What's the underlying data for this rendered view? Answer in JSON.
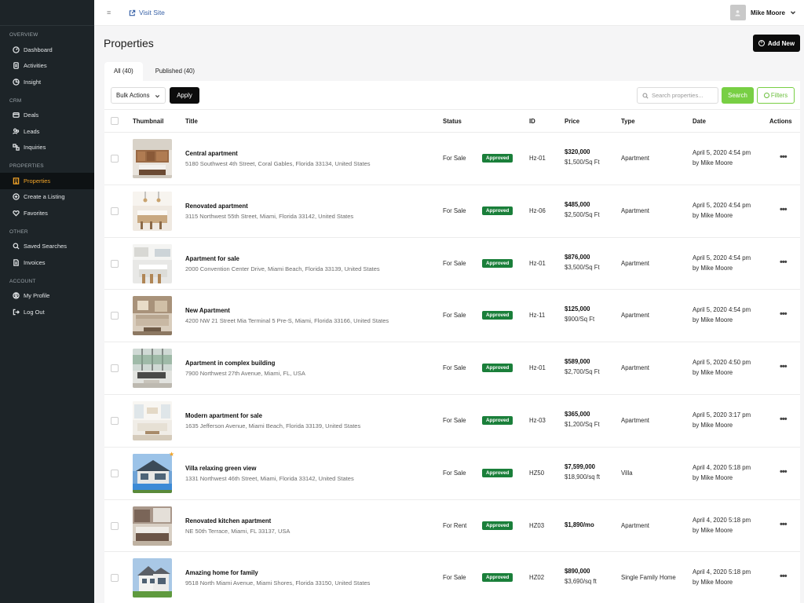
{
  "sidebar": {
    "sections": [
      {
        "title": "OVERVIEW",
        "items": [
          {
            "label": "Dashboard",
            "icon": "dashboard-icon"
          },
          {
            "label": "Activities",
            "icon": "activities-icon"
          },
          {
            "label": "Insight",
            "icon": "insight-icon"
          }
        ]
      },
      {
        "title": "CRM",
        "items": [
          {
            "label": "Deals",
            "icon": "deals-icon"
          },
          {
            "label": "Leads",
            "icon": "leads-icon"
          },
          {
            "label": "Inquiries",
            "icon": "inquiries-icon"
          }
        ]
      },
      {
        "title": "PROPERTIES",
        "items": [
          {
            "label": "Properties",
            "icon": "properties-icon",
            "active": true
          },
          {
            "label": "Create a Listing",
            "icon": "create-listing-icon"
          },
          {
            "label": "Favorites",
            "icon": "heart-icon"
          }
        ]
      },
      {
        "title": "OTHER",
        "items": [
          {
            "label": "Saved Searches",
            "icon": "search-icon"
          },
          {
            "label": "Invoices",
            "icon": "invoice-icon"
          }
        ]
      },
      {
        "title": "ACCOUNT",
        "items": [
          {
            "label": "My Profile",
            "icon": "profile-icon"
          },
          {
            "label": "Log Out",
            "icon": "logout-icon"
          }
        ]
      }
    ],
    "active_color": "#f2a428"
  },
  "topbar": {
    "visit_site": "Visit Site",
    "user_name": "Mike Moore"
  },
  "page": {
    "title": "Properties",
    "add_new": "Add New",
    "add_new_icon": "plus-circle-icon"
  },
  "tabs": [
    {
      "label": "All (40)",
      "active": true
    },
    {
      "label": "Published (40)",
      "active": false
    }
  ],
  "toolbar": {
    "bulk_actions": "Bulk Actions",
    "apply": "Apply",
    "search_placeholder": "Search properties...",
    "search": "Search",
    "filters": "Filters"
  },
  "table": {
    "headers": {
      "thumbnail": "Thumbnail",
      "title": "Title",
      "status": "Status",
      "id": "ID",
      "price": "Price",
      "type": "Type",
      "date": "Date",
      "actions": "Actions"
    },
    "rows": [
      {
        "title": "Central apartment",
        "address": "5180 Southwest 4th Street, Coral Gables, Florida 33134, United States",
        "status": "For Sale",
        "badge": "Approved",
        "id": "Hz-01",
        "price": "$320,000",
        "price_sub": "$1,500/Sq Ft",
        "type": "Apartment",
        "date": "April 5, 2020 4:54 pm",
        "by": "by Mike Moore",
        "thumb": "kitchen-wood",
        "featured": false
      },
      {
        "title": "Renovated apartment",
        "address": "3115 Northwest 55th Street, Miami, Florida 33142, United States",
        "status": "For Sale",
        "badge": "Approved",
        "id": "Hz-06",
        "price": "$485,000",
        "price_sub": "$2,500/Sq Ft",
        "type": "Apartment",
        "date": "April 5, 2020 4:54 pm",
        "by": "by Mike Moore",
        "thumb": "kitchen-light",
        "featured": false
      },
      {
        "title": "Apartment for sale",
        "address": "2000 Convention Center Drive, Miami Beach, Florida 33139, United States",
        "status": "For Sale",
        "badge": "Approved",
        "id": "Hz-01",
        "price": "$876,000",
        "price_sub": "$3,500/Sq Ft",
        "type": "Apartment",
        "date": "April 5, 2020 4:54 pm",
        "by": "by Mike Moore",
        "thumb": "kitchen-white",
        "featured": false
      },
      {
        "title": "New Apartment",
        "address": "4200 NW 21 Street Mia Terminal 5 Pre-S, Miami, Florida 33166, United States",
        "status": "For Sale",
        "badge": "Approved",
        "id": "Hz-11",
        "price": "$125,000",
        "price_sub": "$900/Sq Ft",
        "type": "Apartment",
        "date": "April 5, 2020 4:54 pm",
        "by": "by Mike Moore",
        "thumb": "living-warm",
        "featured": false
      },
      {
        "title": "Apartment in complex building",
        "address": "7900 Northwest 27th Avenue, Miami, FL, USA",
        "status": "For Sale",
        "badge": "Approved",
        "id": "Hz-01",
        "price": "$589,000",
        "price_sub": "$2,700/Sq Ft",
        "type": "Apartment",
        "date": "April 5, 2020 4:50 pm",
        "by": "by Mike Moore",
        "thumb": "living-glass",
        "featured": false
      },
      {
        "title": "Modern apartment for sale",
        "address": "1635 Jefferson Avenue, Miami Beach, Florida 33139, United States",
        "status": "For Sale",
        "badge": "Approved",
        "id": "Hz-03",
        "price": "$365,000",
        "price_sub": "$1,200/Sq Ft",
        "type": "Apartment",
        "date": "April 5, 2020 3:17 pm",
        "by": "by Mike Moore",
        "thumb": "living-bright",
        "featured": false
      },
      {
        "title": "Villa relaxing green view",
        "address": "1331 Northwest 46th Street, Miami, Florida 33142, United States",
        "status": "For Sale",
        "badge": "Approved",
        "id": "HZ50",
        "price": "$7,599,000",
        "price_sub": "$18,900/sq ft",
        "type": "Villa",
        "date": "April 4, 2020 5:18 pm",
        "by": "by Mike Moore",
        "thumb": "villa-pool",
        "featured": true
      },
      {
        "title": "Renovated kitchen apartment",
        "address": "NE 50th Terrace, Miami, FL 33137, USA",
        "status": "For Rent",
        "badge": "Approved",
        "id": "HZ03",
        "price": "$1,890/mo",
        "price_sub": "",
        "type": "Apartment",
        "date": "April 4, 2020 5:18 pm",
        "by": "by Mike Moore",
        "thumb": "kitchen-dark",
        "featured": false
      },
      {
        "title": "Amazing home for family",
        "address": "9518 North Miami Avenue, Miami Shores, Florida 33150, United States",
        "status": "For Sale",
        "badge": "Approved",
        "id": "HZ02",
        "price": "$890,000",
        "price_sub": "$3,690/sq ft",
        "type": "Single Family Home",
        "date": "April 4, 2020 5:18 pm",
        "by": "by Mike Moore",
        "thumb": "house-exterior",
        "featured": false
      }
    ]
  },
  "colors": {
    "sidebar_bg": "#1d2428",
    "badge_green": "#1a7f3a",
    "search_green": "#78cf44"
  }
}
